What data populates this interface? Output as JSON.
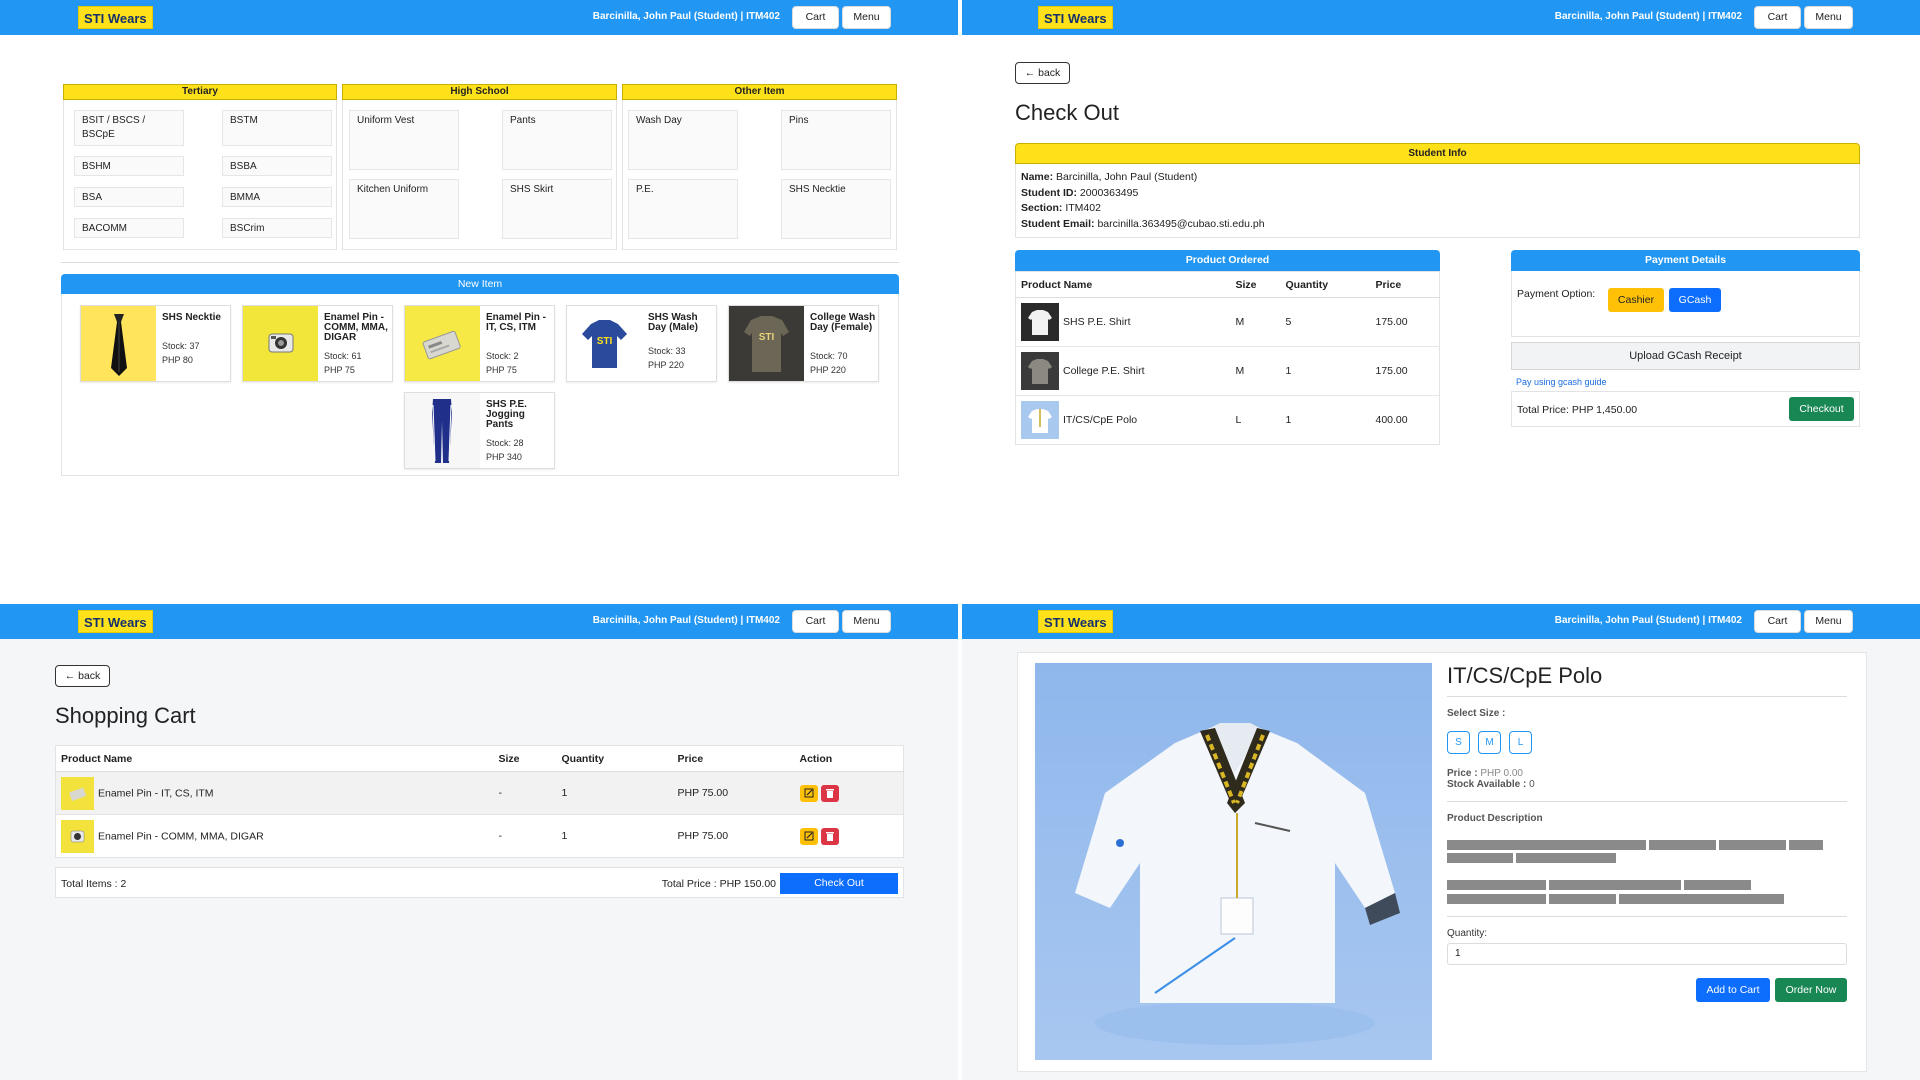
{
  "navbar": {
    "brand": "STI Wears",
    "user": "Barcinilla, John Paul (Student) | ITM402",
    "cart_label": "Cart",
    "menu_label": "Menu"
  },
  "catalog": {
    "columns": [
      {
        "title": "Tertiary",
        "items": [
          "BSIT / BSCS / BSCpE",
          "BSTM",
          "BSHM",
          "BSBA",
          "BSA",
          "BMMA",
          "BACOMM",
          "BSCrim"
        ]
      },
      {
        "title": "High School",
        "items": [
          "Uniform Vest",
          "Pants",
          "Kitchen Uniform",
          "SHS Skirt"
        ]
      },
      {
        "title": "Other Item",
        "items": [
          "Wash Day",
          "Pins",
          "P.E.",
          "SHS Necktie"
        ]
      }
    ],
    "new_item_title": "New Item",
    "new_items": [
      {
        "name": "SHS Necktie",
        "stock": "Stock: 37",
        "price": "PHP 80"
      },
      {
        "name": "Enamel Pin - COMM, MMA, DIGAR",
        "stock": "Stock: 61",
        "price": "PHP 75"
      },
      {
        "name": "Enamel Pin - IT, CS, ITM",
        "stock": "Stock: 2",
        "price": "PHP 75"
      },
      {
        "name": "SHS Wash Day (Male)",
        "stock": "Stock: 33",
        "price": "PHP 220"
      },
      {
        "name": "College Wash Day (Female)",
        "stock": "Stock: 70",
        "price": "PHP 220"
      },
      {
        "name": "SHS P.E. Jogging Pants",
        "stock": "Stock: 28",
        "price": "PHP 340"
      }
    ]
  },
  "checkout": {
    "back_label": "back",
    "title": "Check Out",
    "student_info_title": "Student Info",
    "student": {
      "name_label": "Name:",
      "name": "Barcinilla, John Paul (Student)",
      "id_label": "Student ID:",
      "id": "2000363495",
      "section_label": "Section:",
      "section": "ITM402",
      "email_label": "Student Email:",
      "email": "barcinilla.363495@cubao.sti.edu.ph"
    },
    "product_ordered_title": "Product Ordered",
    "columns": [
      "Product Name",
      "Size",
      "Quantity",
      "Price"
    ],
    "rows": [
      {
        "name": "SHS P.E. Shirt",
        "size": "M",
        "qty": "5",
        "price": "175.00"
      },
      {
        "name": "College P.E. Shirt",
        "size": "M",
        "qty": "1",
        "price": "175.00"
      },
      {
        "name": "IT/CS/CpE Polo",
        "size": "L",
        "qty": "1",
        "price": "400.00"
      }
    ],
    "payment_title": "Payment Details",
    "payment_option_label": "Payment Option:",
    "cashier_label": "Cashier",
    "gcash_label": "GCash",
    "upload_label": "Upload GCash Receipt",
    "guide_link": "Pay using gcash guide",
    "total_price": "Total Price: PHP 1,450.00",
    "checkout_label": "Checkout"
  },
  "cart": {
    "back_label": "back",
    "title": "Shopping Cart",
    "columns": [
      "Product Name",
      "Size",
      "Quantity",
      "Price",
      "Action"
    ],
    "rows": [
      {
        "name": "Enamel Pin - IT, CS, ITM",
        "size": "-",
        "qty": "1",
        "price": "PHP 75.00"
      },
      {
        "name": "Enamel Pin - COMM, MMA, DIGAR",
        "size": "-",
        "qty": "1",
        "price": "PHP 75.00"
      }
    ],
    "total_items": "Total Items : 2",
    "total_price": "Total Price : PHP 150.00",
    "checkout_label": "Check Out"
  },
  "product": {
    "title": "IT/CS/CpE Polo",
    "select_size_label": "Select Size :",
    "sizes": [
      "S",
      "M",
      "L"
    ],
    "price_label": "Price :",
    "price": "PHP 0.00",
    "stock_label": "Stock Available :",
    "stock": "0",
    "description_label": "Product Description",
    "quantity_label": "Quantity:",
    "quantity_value": "1",
    "add_to_cart_label": "Add to Cart",
    "order_now_label": "Order Now"
  },
  "colors": {
    "primary_blue": "#2196f3",
    "brand_yellow": "#ffe11a",
    "success_green": "#198754",
    "warning_yellow": "#ffc107",
    "danger_red": "#dc3545",
    "button_blue": "#0d6efd"
  }
}
